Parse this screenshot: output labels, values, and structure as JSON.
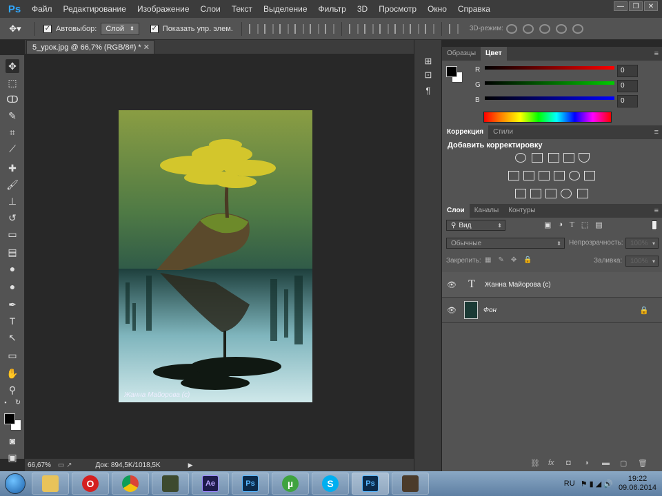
{
  "app": {
    "logo": "Ps"
  },
  "menu": [
    "Файл",
    "Редактирование",
    "Изображение",
    "Слои",
    "Текст",
    "Выделение",
    "Фильтр",
    "3D",
    "Просмотр",
    "Окно",
    "Справка"
  ],
  "window_controls": [
    "minimize-icon",
    "restore-icon",
    "close-icon"
  ],
  "options": {
    "autoselect_label": "Автовыбор:",
    "autoselect_value": "Слой",
    "show_transform_label": "Показать упр. элем.",
    "mode_3d_label": "3D-режим:"
  },
  "document": {
    "tab_title": "5_урок.jpg @ 66,7% (RGB/8#) *",
    "watermark": "Жанна Майорова (с)"
  },
  "status": {
    "zoom": "66,67%",
    "doc_size": "Док: 894,5K/1018,5K"
  },
  "panels": {
    "swatches_tab": "Образцы",
    "color_tab": "Цвет",
    "color": {
      "r_label": "R",
      "g_label": "G",
      "b_label": "B",
      "r_value": "0",
      "g_value": "0",
      "b_value": "0",
      "foreground": "#000000",
      "background": "#ffffff"
    },
    "correction_tab": "Коррекция",
    "styles_tab": "Стили",
    "add_adjustment": "Добавить корректировку",
    "layers_tab": "Слои",
    "channels_tab": "Каналы",
    "paths_tab": "Контуры",
    "filter_kind": "Вид",
    "blend_mode": "Обычные",
    "opacity_label": "Непрозрачность:",
    "opacity_value": "100%",
    "lock_label": "Закрепить:",
    "fill_label": "Заливка:",
    "fill_value": "100%",
    "layers": [
      {
        "name": "Жанна Майорова (с)",
        "kind": "text"
      },
      {
        "name": "Фон",
        "kind": "background"
      }
    ]
  },
  "taskbar": {
    "apps": [
      "explorer",
      "opera",
      "chrome",
      "app-4",
      "after-effects",
      "photoshop",
      "utorrent",
      "skype",
      "photoshop-active",
      "app-10"
    ],
    "ae_label": "Ae",
    "ps_label": "Ps",
    "lang": "RU",
    "time": "19:22",
    "date": "09.06.2014"
  }
}
